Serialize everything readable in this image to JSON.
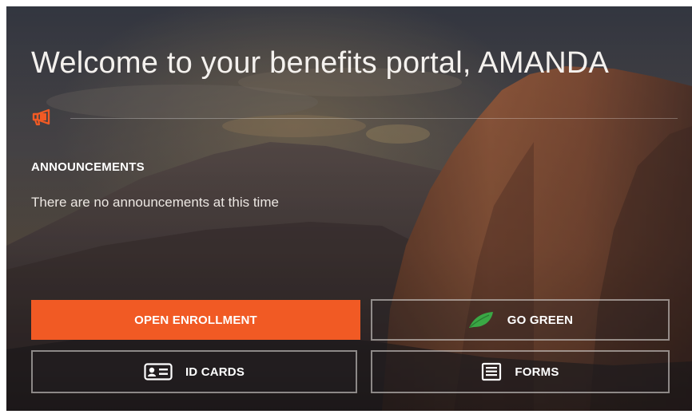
{
  "portal": {
    "welcome_title": "Welcome to your benefits portal, AMANDA",
    "icon": "megaphone-icon",
    "accent_color": "#f15a24",
    "green_color": "#3aa845"
  },
  "announcements": {
    "heading": "ANNOUNCEMENTS",
    "message": "There are no announcements at this time"
  },
  "actions": {
    "open_enrollment": {
      "label": "OPEN ENROLLMENT"
    },
    "go_green": {
      "label": "GO GREEN",
      "icon": "leaf-icon"
    },
    "id_cards": {
      "label": "ID CARDS",
      "icon": "id-card-icon"
    },
    "forms": {
      "label": "FORMS",
      "icon": "form-document-icon"
    }
  }
}
